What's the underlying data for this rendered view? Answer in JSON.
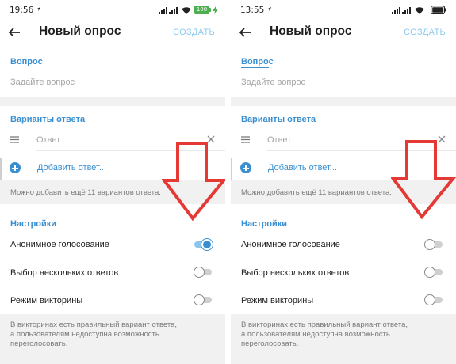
{
  "panels": [
    {
      "status": {
        "time": "19:56",
        "battery": "100"
      },
      "appbar": {
        "title": "Новый опрос",
        "create": "СОЗДАТЬ"
      },
      "question": {
        "label": "Вопрос",
        "placeholder": "Задайте вопрос"
      },
      "answers": {
        "label": "Варианты ответа",
        "item_placeholder": "Ответ",
        "add_label": "Добавить ответ...",
        "hint": "Можно добавить ещё 11 вариантов ответа."
      },
      "settings": {
        "label": "Настройки",
        "items": [
          {
            "label": "Анонимное голосование",
            "on": true
          },
          {
            "label": "Выбор нескольких ответов",
            "on": false
          },
          {
            "label": "Режим викторины",
            "on": false
          }
        ],
        "quiz_hint": [
          "В викторинах есть правильный вариант ответа,",
          "а пользователям недоступна возможность",
          "переголосовать."
        ]
      }
    },
    {
      "status": {
        "time": "13:55",
        "battery": ""
      },
      "appbar": {
        "title": "Новый опрос",
        "create": "СОЗДАТЬ"
      },
      "question": {
        "label": "Вопрос",
        "placeholder": "Задайте вопрос"
      },
      "answers": {
        "label": "Варианты ответа",
        "item_placeholder": "Ответ",
        "add_label": "Добавить ответ...",
        "hint": "Можно добавить ещё 11 вариантов ответа."
      },
      "settings": {
        "label": "Настройки",
        "items": [
          {
            "label": "Анонимное голосование",
            "on": false
          },
          {
            "label": "Выбор нескольких ответов",
            "on": false
          },
          {
            "label": "Режим викторины",
            "on": false
          }
        ],
        "quiz_hint": [
          "В викторинах есть правильный вариант ответа,",
          "а пользователям недоступна возможность",
          "переголосовать."
        ]
      }
    }
  ],
  "colors": {
    "accent": "#3a8fd1",
    "create_disabled": "#8ecbf0",
    "arrow": "#e53935",
    "battery": "#4caf50"
  },
  "icons": [
    "location-icon",
    "signal-icon",
    "wifi-icon",
    "battery-icon",
    "charging-icon",
    "back-arrow-icon",
    "drag-handle-icon",
    "close-icon",
    "add-circle-icon"
  ]
}
